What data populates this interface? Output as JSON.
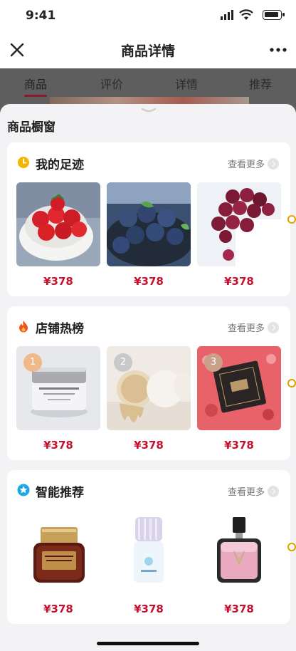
{
  "status_bar": {
    "time": "9:41"
  },
  "navbar": {
    "title": "商品详情"
  },
  "tabs": [
    {
      "label": "商品"
    },
    {
      "label": "评价"
    },
    {
      "label": "详情"
    },
    {
      "label": "推荐"
    }
  ],
  "sheet": {
    "title": "商品橱窗"
  },
  "sections": [
    {
      "title": "我的足迹",
      "icon": "clock-icon",
      "see_more": "查看更多",
      "items": [
        {
          "name": "cherry-tomatoes",
          "price": "¥378"
        },
        {
          "name": "blueberries",
          "price": "¥378"
        },
        {
          "name": "grapes",
          "price": "¥378"
        }
      ]
    },
    {
      "title": "店铺热榜",
      "icon": "flame-icon",
      "see_more": "查看更多",
      "items": [
        {
          "name": "cream-jar",
          "price": "¥378",
          "rank": "1"
        },
        {
          "name": "cushion-compacts",
          "price": "¥378",
          "rank": "2"
        },
        {
          "name": "gift-box",
          "price": "¥378",
          "rank": "3"
        }
      ]
    },
    {
      "title": "智能推荐",
      "icon": "star-icon",
      "see_more": "查看更多",
      "items": [
        {
          "name": "serum-bottle",
          "price": "¥378"
        },
        {
          "name": "sunscreen-bottle",
          "price": "¥378"
        },
        {
          "name": "perfume-bottle",
          "price": "¥378"
        }
      ]
    }
  ],
  "colors": {
    "price": "#c8102e",
    "tab_indicator": "#8b1b2b",
    "accent_dot": "#e0a000"
  }
}
